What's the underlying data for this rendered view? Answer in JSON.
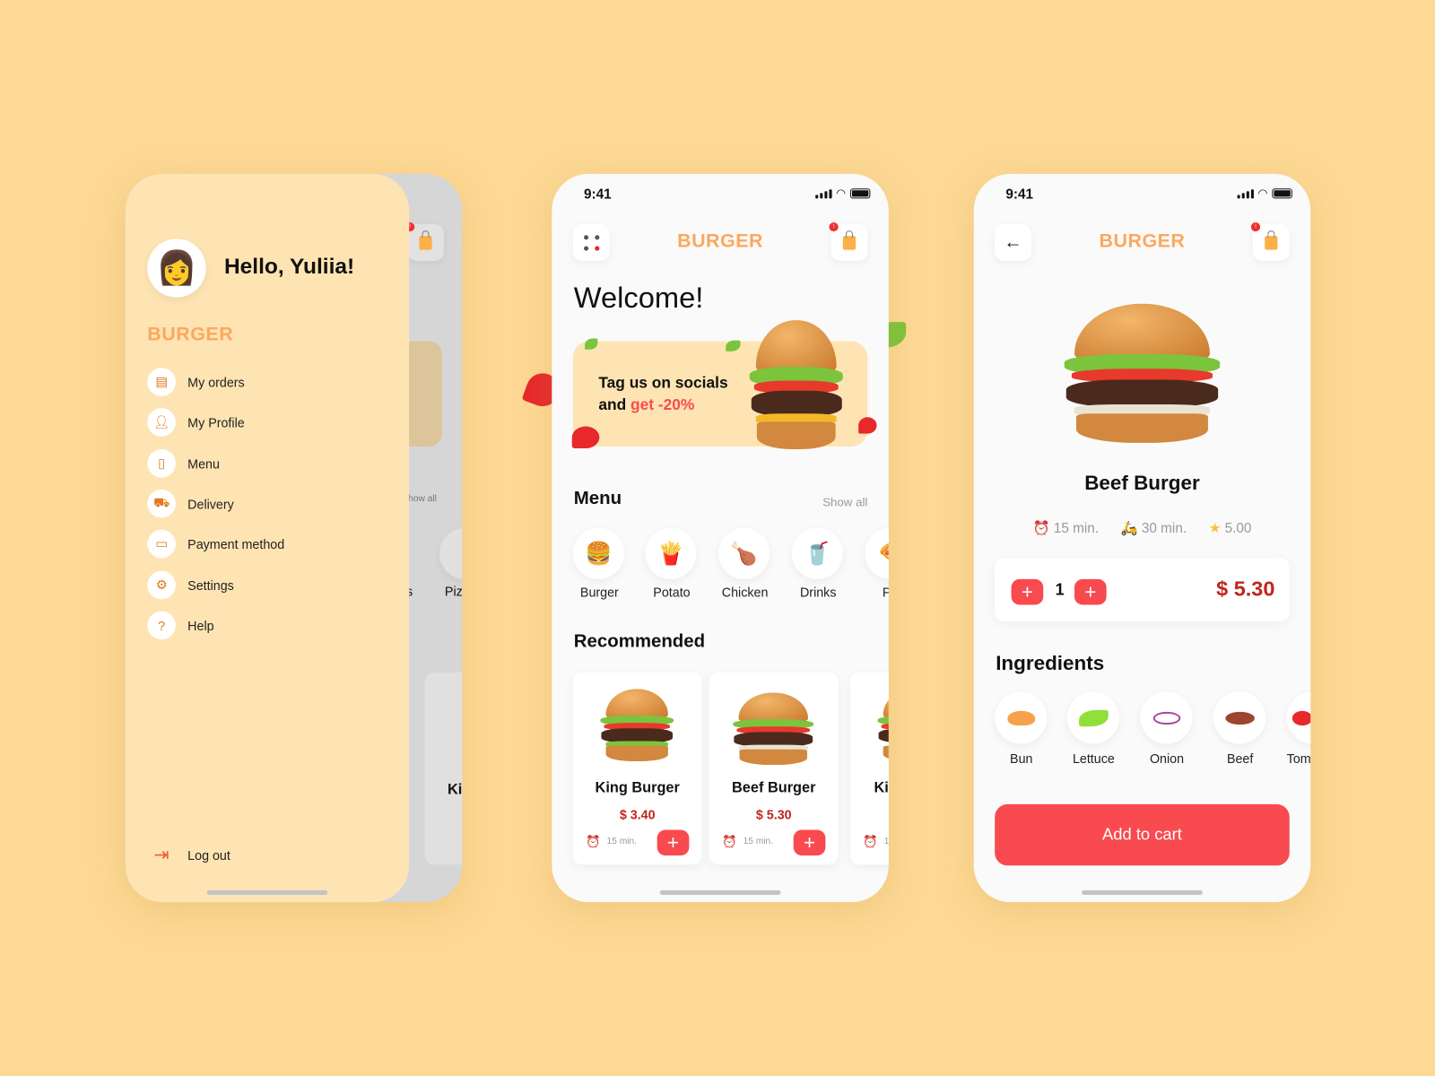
{
  "colors": {
    "background": "#fdd995",
    "brand": "#fca85e",
    "accent_red": "#f84a4f",
    "price_red": "#c0251d",
    "drawer": "#fee4b3"
  },
  "drawer": {
    "greeting": "Hello, Yuliia!",
    "brand": "BURGER",
    "items": [
      {
        "label": "My orders",
        "icon": "receipt-icon"
      },
      {
        "label": "My Profile",
        "icon": "user-icon"
      },
      {
        "label": "Menu",
        "icon": "notebook-icon"
      },
      {
        "label": "Delivery",
        "icon": "truck-icon"
      },
      {
        "label": "Payment method",
        "icon": "wallet-icon"
      },
      {
        "label": "Settings",
        "icon": "gear-icon"
      },
      {
        "label": "Help",
        "icon": "help-chat-icon"
      }
    ],
    "logout": "Log out",
    "behind": {
      "show_all": "how all",
      "cat_partial": "Piz",
      "cat_partial2": "s",
      "card_partial": "Ki",
      "badge": "!"
    }
  },
  "home": {
    "time": "9:41",
    "brand": "BURGER",
    "cart_badge": "!",
    "welcome": "Welcome!",
    "promo": {
      "line1": "Tag us on socials",
      "line2_prefix": "and ",
      "line2_highlight": "get -20%"
    },
    "menu_title": "Menu",
    "show_all": "Show all",
    "categories": [
      {
        "label": "Burger",
        "icon": "🍔"
      },
      {
        "label": "Potato",
        "icon": "🍟"
      },
      {
        "label": "Chicken",
        "icon": "🍗"
      },
      {
        "label": "Drinks",
        "icon": "🥤"
      },
      {
        "label": "Piz",
        "icon": "🍕"
      }
    ],
    "recommended_title": "Recommended",
    "cards": [
      {
        "name": "King Burger",
        "price": "$ 3.40",
        "time": "15 min.",
        "add": "+"
      },
      {
        "name": "Beef Burger",
        "price": "$ 5.30",
        "time": "15 min.",
        "add": "+"
      },
      {
        "name": "Ki",
        "price": "",
        "time": "1",
        "add": ""
      }
    ]
  },
  "detail": {
    "time": "9:41",
    "brand": "BURGER",
    "cart_badge": "!",
    "title": "Beef Burger",
    "prep_time": "15 min.",
    "delivery_time": "30 min.",
    "rating": "5.00",
    "quantity": "1",
    "minus": "+",
    "plus": "+",
    "price": "$ 5.30",
    "ingredients_title": "Ingredients",
    "ingredients": [
      "Bun",
      "Lettuce",
      "Onion",
      "Beef",
      "Tom"
    ],
    "add_to_cart": "Add to cart"
  }
}
